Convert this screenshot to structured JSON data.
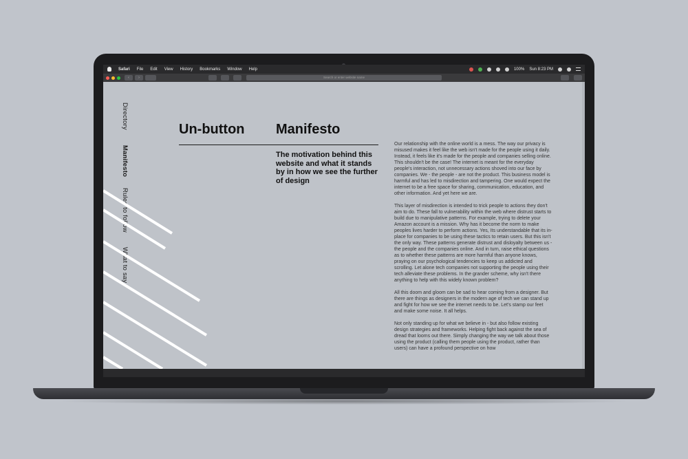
{
  "menubar": {
    "app": "Safari",
    "items": [
      "File",
      "Edit",
      "View",
      "History",
      "Bookmarks",
      "Window",
      "Help"
    ],
    "battery": "100%",
    "clock": "Sun 8:23 PM"
  },
  "browser": {
    "url_placeholder": "Search or enter website name"
  },
  "nav": {
    "directory": "Directory",
    "manifesto": "Manifesto",
    "rules": "Rules to follow",
    "what_to_say": "What to say"
  },
  "heading": {
    "site": "Un-button",
    "page": "Manifesto",
    "subtitle": "The motivation behind this website and what it stands by in how we see the further of design"
  },
  "paragraphs": [
    "Our relationship with the online world is a mess. The way our privacy is misused makes it feel like the web isn't made for the people using it daily. Instead, it feels like it's made for the people and companies selling online. This shouldn't be the case! The internet is meant for the everyday people's interaction, not unnecessary actions shoved into our face by companies. We - the people - are not the product. This business model is harmful and has led to misdirection and tampering. One would expect the internet to be a free space for sharing, communication, education, and other information. And yet here we are.",
    "This layer of misdirection is intended to trick people to actions they don't aim to do. These fall to vulnerability within the web where distrust starts to build due to manipulative patterns. For example, trying to delete your Amazon account is a mission. Why has it become the norm to make peoples lives harder to perform actions. Yes, Its understandable that its in-place for companies to be using these tactics to retain users. But this isn't the only way. These patterns generate distrust and disloyalty between us - the people and the companies online. And in turn, raise ethical questions as to whether these patterns are more harmful than anyone knows, praying on our psychological tendencies to keep us addicted and scrolling. Let alone tech companies not supporting the people using their tech alleviate these problems. In the grander scheme, why isn't there anything to help with this widely known problem?",
    "All this doom and gloom can be sad to hear coming from a designer. But there are things as designers in the modern age of tech we can stand up and fight for how we see the internet needs to be. Let's stamp our feet and make some noise. It all helps.",
    "Not only standing up for what we believe in - but also follow existing design strategies and frameworks. Helping fight back against the sea of dread that looms out there. Simply changing the way we talk about those using the product (calling them people using the product, rather than users) can have a profound perspective on how"
  ]
}
